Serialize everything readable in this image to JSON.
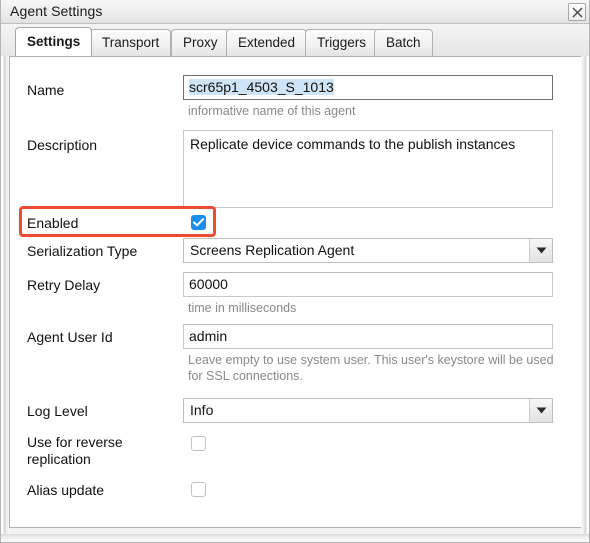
{
  "window": {
    "title": "Agent Settings",
    "close_icon": "close-x-icon"
  },
  "tabs": [
    {
      "label": "Settings",
      "active": true
    },
    {
      "label": "Transport",
      "active": false
    },
    {
      "label": "Proxy",
      "active": false
    },
    {
      "label": "Extended",
      "active": false
    },
    {
      "label": "Triggers",
      "active": false
    },
    {
      "label": "Batch",
      "active": false
    }
  ],
  "form": {
    "name": {
      "label": "Name",
      "value": "scr65p1_4503_S_1013",
      "helper": "informative name of this agent"
    },
    "description": {
      "label": "Description",
      "value": "Replicate device commands to the publish instances"
    },
    "enabled": {
      "label": "Enabled",
      "checked": true
    },
    "serialization_type": {
      "label": "Serialization Type",
      "value": "Screens Replication Agent",
      "arrow_icon": "chevron-down-icon"
    },
    "retry_delay": {
      "label": "Retry Delay",
      "value": "60000",
      "helper": "time in milliseconds"
    },
    "agent_user_id": {
      "label": "Agent User Id",
      "value": "admin",
      "helper": "Leave empty to use system user. This user's keystore will be used for SSL connections."
    },
    "log_level": {
      "label": "Log Level",
      "value": "Info",
      "arrow_icon": "chevron-down-icon"
    },
    "use_for_reverse_replication": {
      "label": "Use for reverse\nreplication",
      "checked": false
    },
    "alias_update": {
      "label": "Alias update",
      "checked": false
    }
  },
  "annotation": {
    "highlight_color": "#ef4b33",
    "target": "enabled-row"
  },
  "colors": {
    "accent": "#1a8cf0",
    "selection": "#cfe4f7",
    "helper_text": "#8a8a8a",
    "highlight": "#ef4b33"
  }
}
